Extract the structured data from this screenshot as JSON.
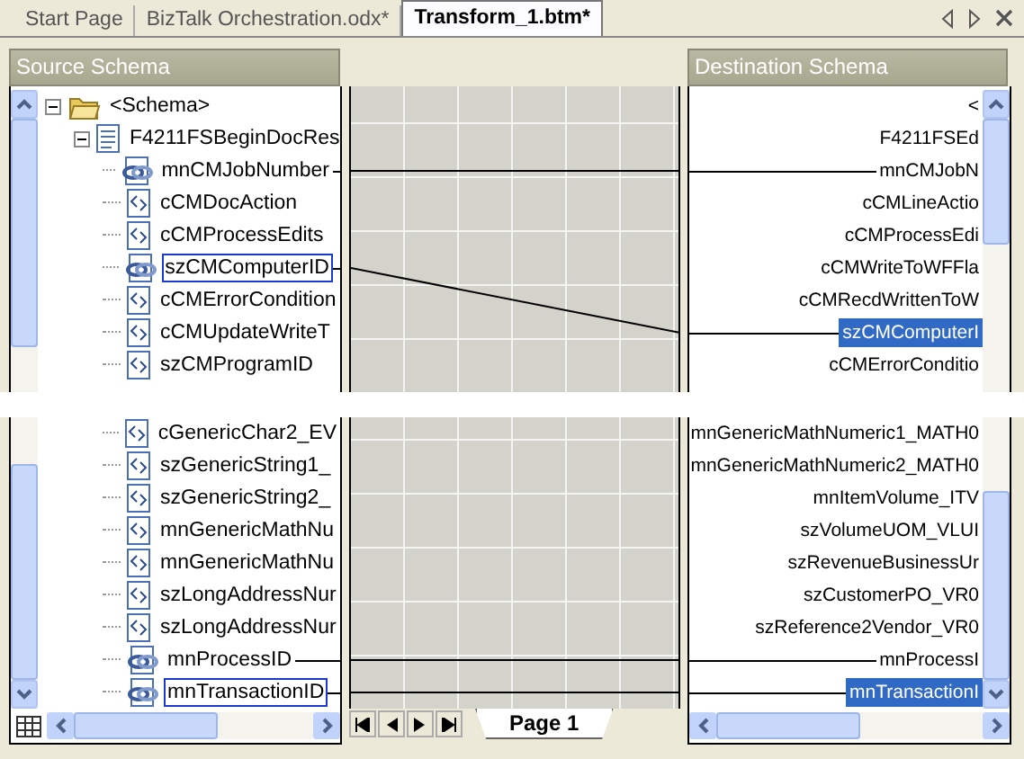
{
  "tabs": [
    {
      "label": "Start Page",
      "selected": false
    },
    {
      "label": "BizTalk Orchestration.odx*",
      "selected": false
    },
    {
      "label": "Transform_1.btm*",
      "selected": true
    }
  ],
  "source_schema": {
    "header": "Source Schema",
    "tree": [
      {
        "label": "<Schema>",
        "kind": "root",
        "expanded": true,
        "selected": false,
        "children": [
          {
            "label": "F4211FSBeginDocRes",
            "kind": "record",
            "expanded": true,
            "selected": false,
            "children": [
              {
                "label": "mnCMJobNumber",
                "kind": "field",
                "selected": false,
                "linked": true
              },
              {
                "label": "cCMDocAction",
                "kind": "field",
                "selected": false,
                "linked": false
              },
              {
                "label": "cCMProcessEdits",
                "kind": "field",
                "selected": false,
                "linked": false
              },
              {
                "label": "szCMComputerID",
                "kind": "field",
                "selected": true,
                "linked": true
              },
              {
                "label": "cCMErrorCondition",
                "kind": "field",
                "selected": false,
                "linked": false
              },
              {
                "label": "cCMUpdateWriteT",
                "kind": "field",
                "selected": false,
                "linked": false
              },
              {
                "label": "szCMProgramID",
                "kind": "field",
                "selected": false,
                "linked": false
              }
            ],
            "children_after_break": [
              {
                "label": "cGenericChar2_EV",
                "kind": "field",
                "selected": false,
                "linked": false
              },
              {
                "label": "szGenericString1_",
                "kind": "field",
                "selected": false,
                "linked": false
              },
              {
                "label": "szGenericString2_",
                "kind": "field",
                "selected": false,
                "linked": false
              },
              {
                "label": "mnGenericMathNu",
                "kind": "field",
                "selected": false,
                "linked": false
              },
              {
                "label": "mnGenericMathNu",
                "kind": "field",
                "selected": false,
                "linked": false
              },
              {
                "label": "szLongAddressNur",
                "kind": "field",
                "selected": false,
                "linked": false
              },
              {
                "label": "szLongAddressNur",
                "kind": "field",
                "selected": false,
                "linked": false
              },
              {
                "label": "mnProcessID",
                "kind": "field",
                "selected": false,
                "linked": true
              },
              {
                "label": "mnTransactionID",
                "kind": "field",
                "selected": true,
                "linked": true
              }
            ]
          }
        ]
      }
    ]
  },
  "grid": {
    "page_tab": "Page 1"
  },
  "destination_schema": {
    "header": "Destination Schema",
    "tree": [
      {
        "label": "<",
        "selected": false,
        "children": [
          {
            "label": "F4211FSEd",
            "selected": false,
            "children": [
              {
                "label": "mnCMJobN",
                "selected": false,
                "linked": true
              },
              {
                "label": "cCMLineActio",
                "selected": false,
                "linked": false
              },
              {
                "label": "cCMProcessEdi",
                "selected": false,
                "linked": false
              },
              {
                "label": "cCMWriteToWFFla",
                "selected": false,
                "linked": false
              },
              {
                "label": "cCMRecdWrittenToW",
                "selected": false,
                "linked": false
              },
              {
                "label": "szCMComputerI",
                "selected": true,
                "linked": true
              },
              {
                "label": "cCMErrorConditio",
                "selected": false,
                "linked": false
              }
            ],
            "children_after_break": [
              {
                "label": "mnGenericMathNumeric1_MATH0",
                "selected": false,
                "linked": false
              },
              {
                "label": "mnGenericMathNumeric2_MATH0",
                "selected": false,
                "linked": false
              },
              {
                "label": "mnItemVolume_ITV",
                "selected": false,
                "linked": false
              },
              {
                "label": "szVolumeUOM_VLUI",
                "selected": false,
                "linked": false
              },
              {
                "label": "szRevenueBusinessUr",
                "selected": false,
                "linked": false
              },
              {
                "label": "szCustomerPO_VR0",
                "selected": false,
                "linked": false
              },
              {
                "label": "szReference2Vendor_VR0",
                "selected": false,
                "linked": false
              },
              {
                "label": "mnProcessI",
                "selected": false,
                "linked": true
              },
              {
                "label": "mnTransactionI",
                "selected": true,
                "linked": true
              }
            ]
          }
        ]
      }
    ]
  }
}
